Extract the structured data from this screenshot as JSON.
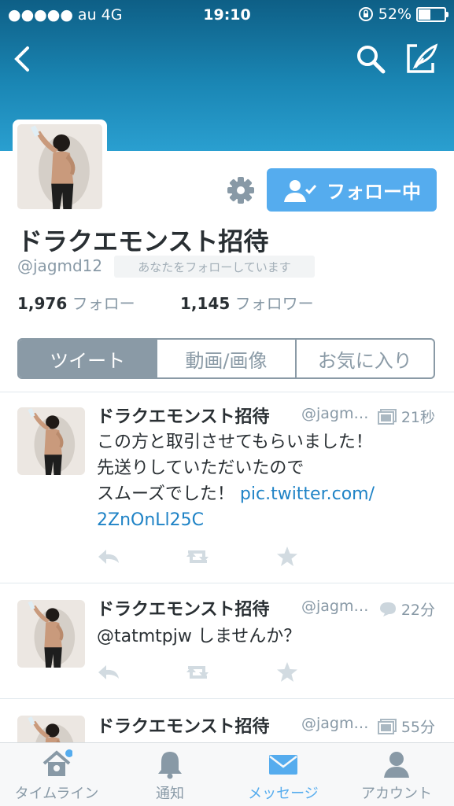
{
  "status_bar": {
    "carrier": "●●●●● au  4G",
    "time": "19:10",
    "battery": "52%",
    "battery_level": 0.52
  },
  "profile": {
    "name": "ドラクエモンスト招待",
    "handle": "@jagmd12",
    "follows_you": "あなたをフォローしています",
    "follow_button_label": "フォロー中",
    "following_count": "1,976",
    "following_label": "フォロー",
    "followers_count": "1,145",
    "followers_label": "フォロワー"
  },
  "tabs": [
    "ツイート",
    "動画/画像",
    "お気に入り"
  ],
  "tweets": [
    {
      "name": "ドラクエモンスト招待",
      "handle": "@jagm…",
      "time": "21秒",
      "meta_icon": "gallery-icon",
      "text": [
        "この方と取引させてもらいました！",
        "先送りしていただいたので",
        "スムーズでした！ "
      ],
      "link": [
        "pic.twitter.com/",
        "2ZnOnLl25C"
      ]
    },
    {
      "name": "ドラクエモンスト招待",
      "handle": "@jagm…",
      "time": "22分",
      "meta_icon": "reply-bubble-icon",
      "text": [
        "@tatmtpjw しませんか？"
      ]
    },
    {
      "name": "ドラクエモンスト招待",
      "handle": "@jagm…",
      "time": "55分",
      "meta_icon": "gallery-icon"
    }
  ],
  "tabbar": [
    "タイムライン",
    "通知",
    "メッセージ",
    "アカウント"
  ],
  "colors": {
    "accent": "#55acee",
    "link": "#1f83c6",
    "header": "#1a86b4",
    "segment": "#8a9aa6"
  }
}
